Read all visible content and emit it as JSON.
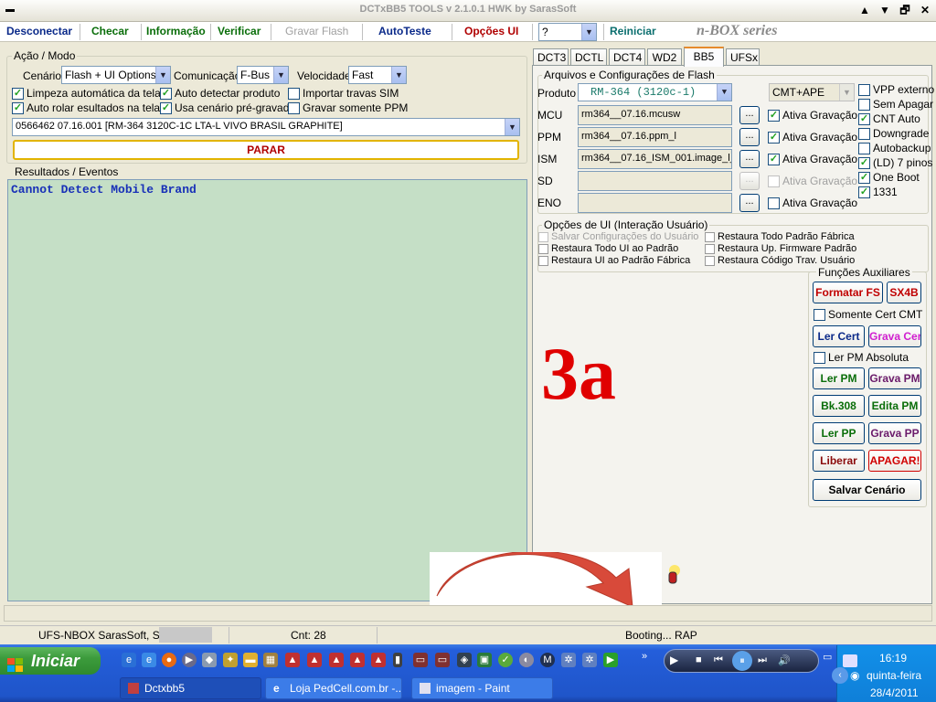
{
  "window": {
    "title": "DCTxBB5 TOOLS v 2.1.0.1 HWK by SarasSoft",
    "minimize": "▲",
    "restore": "▼",
    "max": "🗗",
    "close": "✕",
    "system": "▬"
  },
  "menu": {
    "desconectar": "Desconectar",
    "checar": "Checar",
    "informacao": "Informação",
    "verificar": "Verificar",
    "gravar_flash": "Gravar Flash",
    "autoteste": "AutoTeste",
    "opcoes_ui": "Opções UI",
    "help_value": "?",
    "reiniciar": "Reiniciar",
    "brand": "n-BOX series"
  },
  "acao": {
    "legend": "Ação / Modo",
    "cenario_label": "Cenário",
    "cenario_value": "Flash + UI Options",
    "comunicacao_label": "Comunicação",
    "comunicacao_value": "F-Bus",
    "velocidade_label": "Velocidade",
    "velocidade_value": "Fast",
    "checks": [
      {
        "label": "Limpeza automática da tela",
        "checked": true
      },
      {
        "label": "Auto detectar produto",
        "checked": true
      },
      {
        "label": "Importar travas SIM",
        "checked": false
      },
      {
        "label": "Auto rolar esultados na tela",
        "checked": true
      },
      {
        "label": "Usa cenário pré-gravado",
        "checked": true
      },
      {
        "label": "Gravar somente PPM",
        "checked": false
      }
    ],
    "product_value": "0566462 07.16.001  [RM-364 3120C-1C LTA-L VIVO BRASIL GRAPHITE]",
    "parar": "PARAR"
  },
  "resultados": {
    "legend": "Resultados / Eventos",
    "text": "Cannot Detect Mobile Brand"
  },
  "tabs": [
    "DCT3",
    "DCTL",
    "DCT4",
    "WD2",
    "BB5",
    "UFSx"
  ],
  "active_tab": "BB5",
  "flash": {
    "legend": "Arquivos e Configurações de Flash",
    "produto_label": "Produto",
    "produto_value": "RM-364  (3120c-1)",
    "cmt_value": "CMT+APE",
    "rows": [
      {
        "label": "MCU",
        "value": "rm364__07.16.mcusw",
        "btn": "...",
        "ativa": "Ativa Gravação",
        "checked": true,
        "enabled": true
      },
      {
        "label": "PPM",
        "value": "rm364__07.16.ppm_l",
        "btn": "...",
        "ativa": "Ativa Gravação",
        "checked": true,
        "enabled": true
      },
      {
        "label": "ISM",
        "value": "rm364__07.16_ISM_001.image_l_",
        "btn": "...",
        "ativa": "Ativa Gravação",
        "checked": true,
        "enabled": true
      },
      {
        "label": "SD",
        "value": "",
        "btn": "...",
        "ativa": "Ativa Gravação",
        "checked": false,
        "enabled": false
      },
      {
        "label": "ENO",
        "value": "",
        "btn": "...",
        "ativa": "Ativa Gravação",
        "checked": false,
        "enabled": true
      }
    ],
    "right_checks": [
      {
        "label": "VPP externo",
        "checked": false
      },
      {
        "label": "Sem Apagar",
        "checked": false
      },
      {
        "label": "CNT Auto",
        "checked": true
      },
      {
        "label": "Downgrade",
        "checked": false
      },
      {
        "label": "Autobackup",
        "checked": false
      },
      {
        "label": "(LD) 7 pinos",
        "checked": true
      },
      {
        "label": "One Boot",
        "checked": true
      },
      {
        "label": "1331",
        "checked": true
      }
    ]
  },
  "ui_opts": {
    "legend": "Opções de UI (Interação Usuário)",
    "items": [
      {
        "label": "Salvar Configurações do Usuário",
        "enabled": false
      },
      {
        "label": "Restaura Todo Padrão Fábrica",
        "enabled": true
      },
      {
        "label": "Restaura Todo UI ao Padrão",
        "enabled": true
      },
      {
        "label": "Restaura Up. Firmware Padrão",
        "enabled": true
      },
      {
        "label": "Restaura UI ao Padrão Fábrica",
        "enabled": true
      },
      {
        "label": "Restaura Código Trav. Usuário",
        "enabled": true
      }
    ]
  },
  "aux": {
    "legend": "Funções Auxiliares",
    "formatar": "Formatar FS",
    "sx4b": "SX4B",
    "somente_cert": "Somente Cert CMT",
    "ler_cert": "Ler Cert",
    "grava_cert": "Grava Cert",
    "ler_pm_abs": "Ler PM Absoluta",
    "ler_pm": "Ler PM",
    "grava_pm": "Grava PM",
    "bk308": "Bk.308",
    "edita_pm": "Edita PM",
    "ler_pp": "Ler PP",
    "grava_pp": "Grava PP",
    "liberar": "Liberar",
    "apagar": "APAGAR!",
    "salvar": "Salvar Cenário"
  },
  "overlay": {
    "big": "3a"
  },
  "status": {
    "serial": "UFS-NBOX  SarasSoft, S/n:",
    "cnt": "Cnt: 28",
    "boot": "Booting... RAP"
  },
  "taskbar": {
    "start": "Iniciar",
    "items": [
      "Dctxbb5",
      "Loja PedCell.com.br -...",
      "imagem - Paint"
    ],
    "clock": "16:19",
    "day": "quinta-feira",
    "date": "28/4/2011"
  }
}
